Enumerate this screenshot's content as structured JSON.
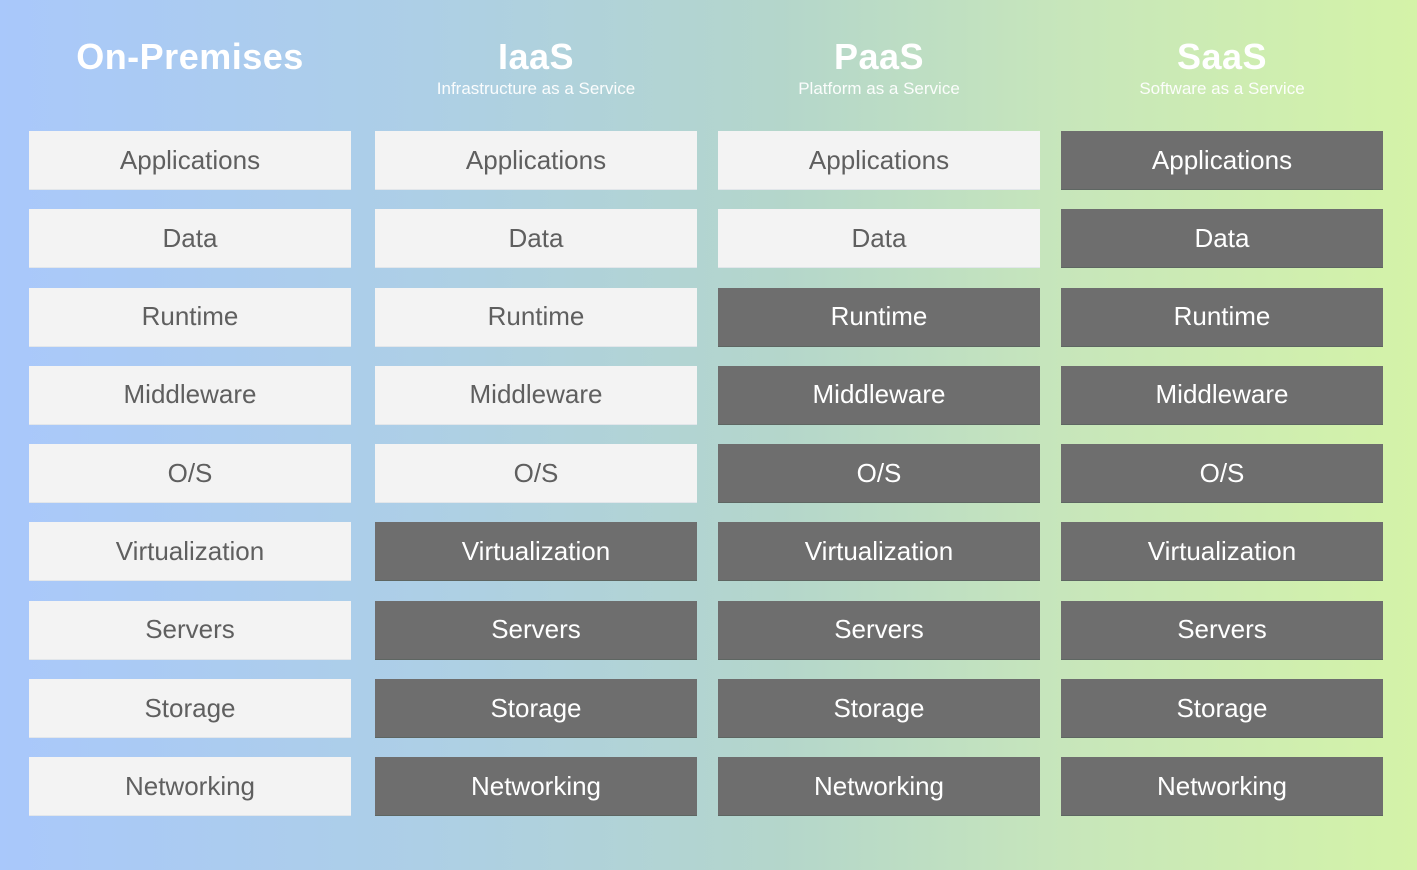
{
  "colors": {
    "customer_managed_bg": "#f3f3f3",
    "customer_managed_text": "#5f5f5f",
    "vendor_managed_bg": "#6e6e6e",
    "vendor_managed_text": "#ffffff",
    "background_gradient_start": "#a9c8fb",
    "background_gradient_end": "#d4f3a8"
  },
  "layers": [
    "Applications",
    "Data",
    "Runtime",
    "Middleware",
    "O/S",
    "Virtualization",
    "Servers",
    "Storage",
    "Networking"
  ],
  "columns": [
    {
      "title": "On-Premises",
      "subtitle": "",
      "cells": [
        {
          "label": "Applications",
          "managed_by": "customer"
        },
        {
          "label": "Data",
          "managed_by": "customer"
        },
        {
          "label": "Runtime",
          "managed_by": "customer"
        },
        {
          "label": "Middleware",
          "managed_by": "customer"
        },
        {
          "label": "O/S",
          "managed_by": "customer"
        },
        {
          "label": "Virtualization",
          "managed_by": "customer"
        },
        {
          "label": "Servers",
          "managed_by": "customer"
        },
        {
          "label": "Storage",
          "managed_by": "customer"
        },
        {
          "label": "Networking",
          "managed_by": "customer"
        }
      ]
    },
    {
      "title": "IaaS",
      "subtitle": "Infrastructure as a Service",
      "cells": [
        {
          "label": "Applications",
          "managed_by": "customer"
        },
        {
          "label": "Data",
          "managed_by": "customer"
        },
        {
          "label": "Runtime",
          "managed_by": "customer"
        },
        {
          "label": "Middleware",
          "managed_by": "customer"
        },
        {
          "label": "O/S",
          "managed_by": "customer"
        },
        {
          "label": "Virtualization",
          "managed_by": "vendor"
        },
        {
          "label": "Servers",
          "managed_by": "vendor"
        },
        {
          "label": "Storage",
          "managed_by": "vendor"
        },
        {
          "label": "Networking",
          "managed_by": "vendor"
        }
      ]
    },
    {
      "title": "PaaS",
      "subtitle": "Platform as a Service",
      "cells": [
        {
          "label": "Applications",
          "managed_by": "customer"
        },
        {
          "label": "Data",
          "managed_by": "customer"
        },
        {
          "label": "Runtime",
          "managed_by": "vendor"
        },
        {
          "label": "Middleware",
          "managed_by": "vendor"
        },
        {
          "label": "O/S",
          "managed_by": "vendor"
        },
        {
          "label": "Virtualization",
          "managed_by": "vendor"
        },
        {
          "label": "Servers",
          "managed_by": "vendor"
        },
        {
          "label": "Storage",
          "managed_by": "vendor"
        },
        {
          "label": "Networking",
          "managed_by": "vendor"
        }
      ]
    },
    {
      "title": "SaaS",
      "subtitle": "Software as a Service",
      "cells": [
        {
          "label": "Applications",
          "managed_by": "vendor"
        },
        {
          "label": "Data",
          "managed_by": "vendor"
        },
        {
          "label": "Runtime",
          "managed_by": "vendor"
        },
        {
          "label": "Middleware",
          "managed_by": "vendor"
        },
        {
          "label": "O/S",
          "managed_by": "vendor"
        },
        {
          "label": "Virtualization",
          "managed_by": "vendor"
        },
        {
          "label": "Servers",
          "managed_by": "vendor"
        },
        {
          "label": "Storage",
          "managed_by": "vendor"
        },
        {
          "label": "Networking",
          "managed_by": "vendor"
        }
      ]
    }
  ]
}
